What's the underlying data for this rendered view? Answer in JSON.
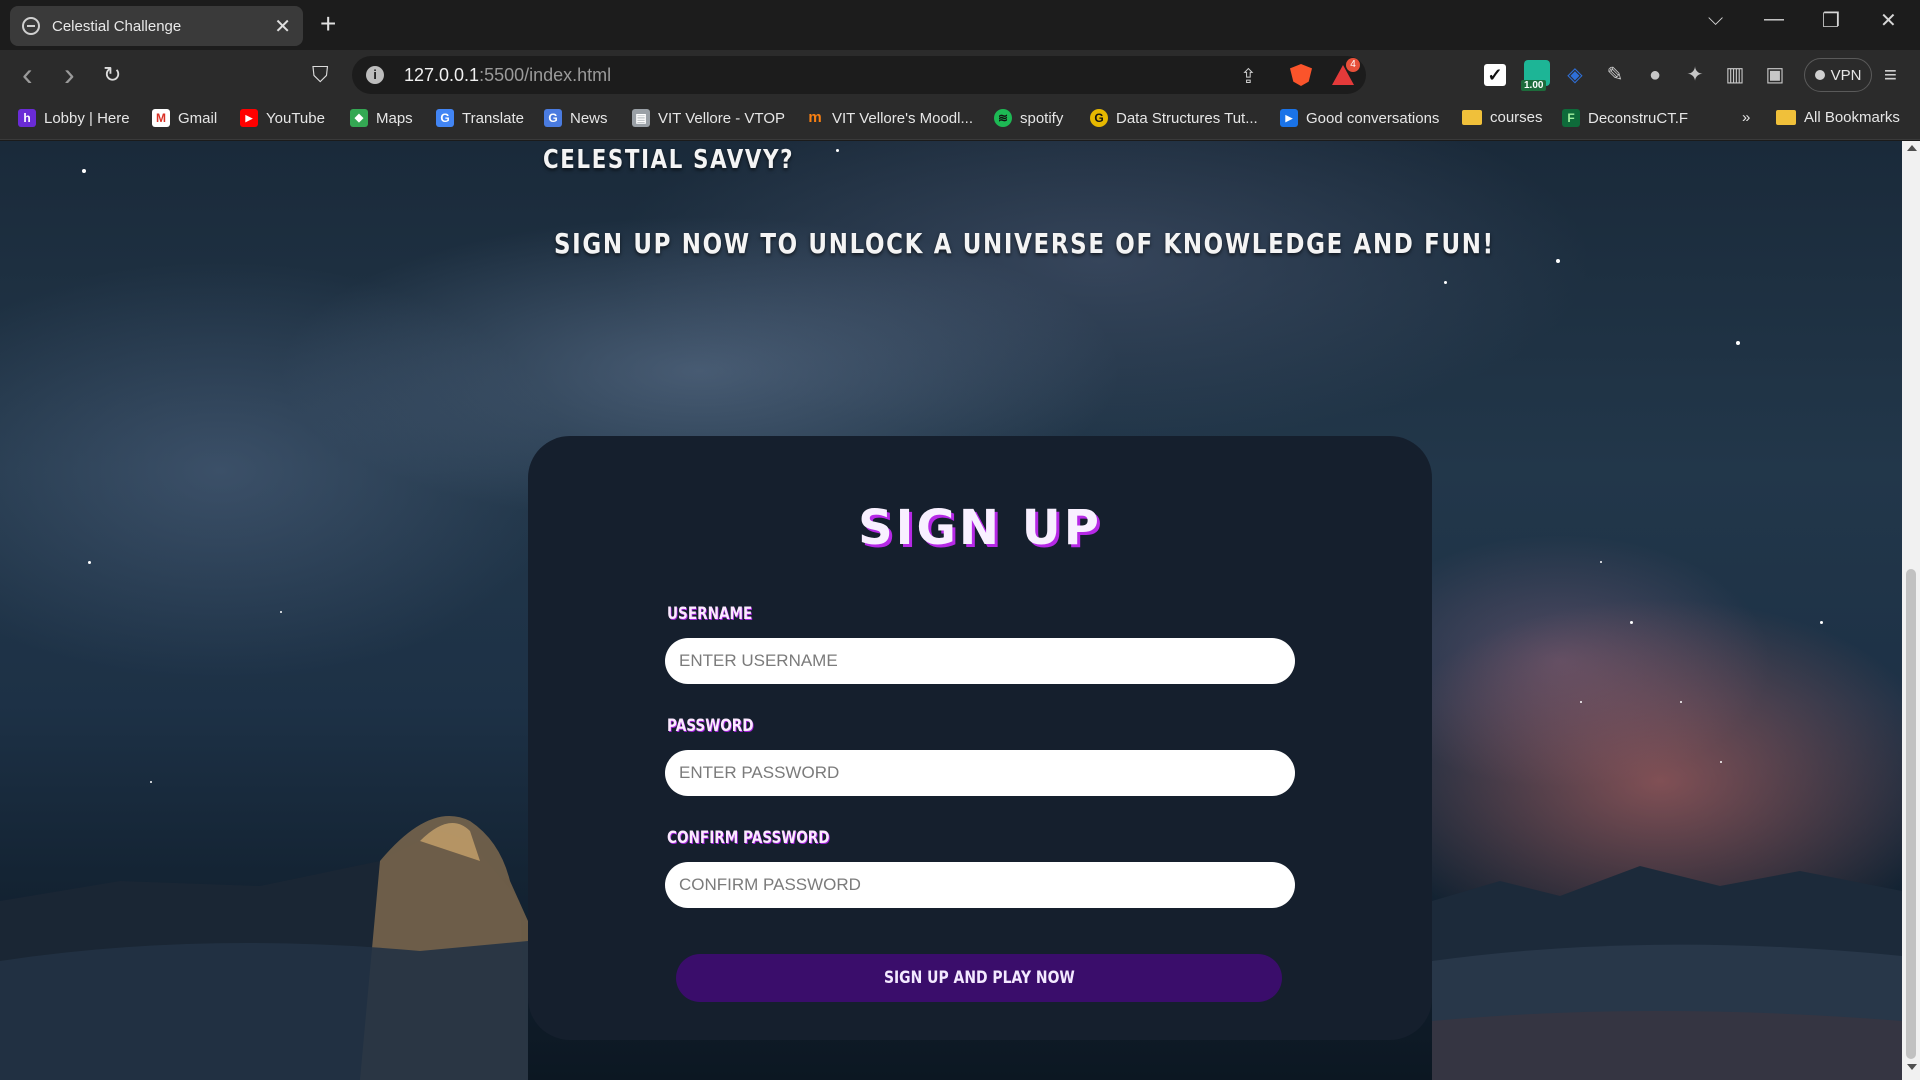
{
  "browser": {
    "tab": {
      "title": "Celestial Challenge",
      "close": "✕"
    },
    "new_tab": "+",
    "window": {
      "chevron": "⌵",
      "minimize": "—",
      "restore": "❐",
      "close": "✕"
    },
    "nav": {
      "back": "‹",
      "forward": "›",
      "reload": "↻",
      "bookmark": "⛉"
    },
    "url": {
      "host": "127.0.0.1",
      "path": ":5500/index.html"
    },
    "rewards_count": "4",
    "extensions": {
      "meter_value": "1.00",
      "vpn_label": "VPN"
    },
    "menu": "≡"
  },
  "bookmarks": [
    {
      "label": "Lobby | Here",
      "icon": "h",
      "color": "#6a2bd6"
    },
    {
      "label": "Gmail",
      "icon": "M",
      "color": "#d93025"
    },
    {
      "label": "YouTube",
      "icon": "▶",
      "color": "#ff0000"
    },
    {
      "label": "Maps",
      "icon": "◆",
      "color": "#34a853"
    },
    {
      "label": "Translate",
      "icon": "G",
      "color": "#4285f4"
    },
    {
      "label": "News",
      "icon": "G",
      "color": "#4a7be0"
    },
    {
      "label": "VIT Vellore - VTOP",
      "icon": "▤",
      "color": "#9aa0a6"
    },
    {
      "label": "VIT Vellore's Moodl...",
      "icon": "m",
      "color": "#f98012"
    },
    {
      "label": "spotify",
      "icon": "≋",
      "color": "#1db954"
    },
    {
      "label": "Data Structures Tut...",
      "icon": "G",
      "color": "#e6b800"
    },
    {
      "label": "Good conversations",
      "icon": "▶",
      "color": "#1a73e8"
    },
    {
      "label": "courses",
      "icon": "",
      "color": "#f0c03a"
    },
    {
      "label": "DeconstruCT.F",
      "icon": "F",
      "color": "#0e6b3a"
    }
  ],
  "bookmarks_more": "»",
  "all_bookmarks": "All Bookmarks",
  "page": {
    "hero_line1": "CELESTIAL SAVVY?",
    "hero_line2": "SIGN UP NOW TO UNLOCK A UNIVERSE OF KNOWLEDGE AND FUN!",
    "form": {
      "title": "SIGN UP",
      "username_label": "USERNAME",
      "username_placeholder": "ENTER USERNAME",
      "password_label": "PASSWORD",
      "password_placeholder": "ENTER PASSWORD",
      "confirm_label": "CONFIRM PASSWORD",
      "confirm_placeholder": "CONFIRM PASSWORD",
      "submit": "SIGN UP AND PLAY NOW"
    }
  },
  "colors": {
    "card_bg": "#151f2d",
    "title_shadow": "#b629e6",
    "button_bg": "#3a0d6b"
  }
}
